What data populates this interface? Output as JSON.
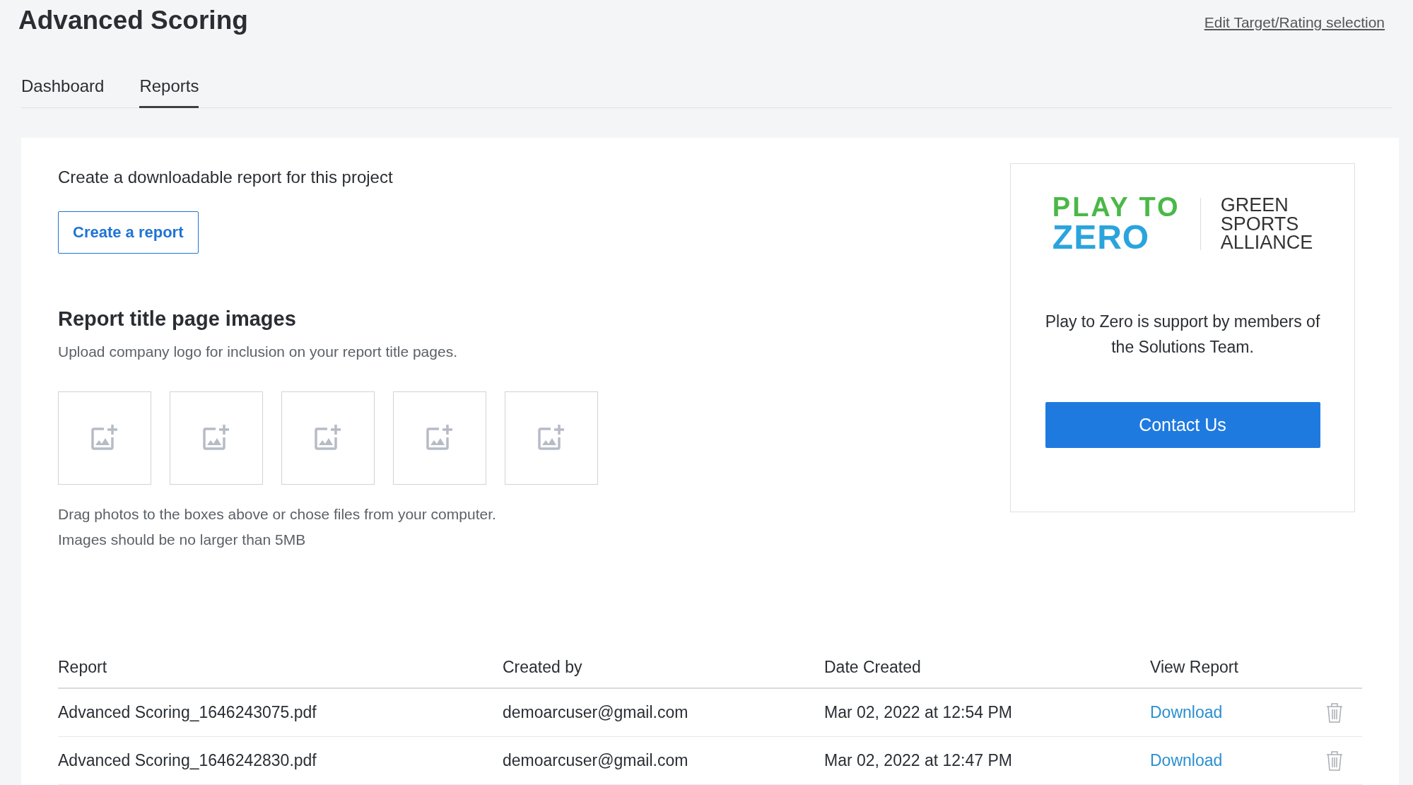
{
  "header": {
    "title": "Advanced Scoring",
    "edit_link": "Edit Target/Rating selection"
  },
  "tabs": [
    {
      "label": "Dashboard",
      "selected": false
    },
    {
      "label": "Reports",
      "selected": true
    }
  ],
  "create": {
    "text": "Create a downloadable report for this project",
    "button": "Create a report"
  },
  "images": {
    "heading": "Report title page images",
    "subtitle": "Upload company logo for inclusion on your report title pages.",
    "slots": [
      {
        "kind": "empty"
      },
      {
        "kind": "empty"
      },
      {
        "kind": "empty"
      },
      {
        "kind": "empty"
      },
      {
        "kind": "empty"
      }
    ],
    "hint_lines": [
      "Drag photos to the boxes above or chose files from your computer.",
      "Images should be no larger than 5MB"
    ]
  },
  "sponsor": {
    "logo_left": [
      "PLAY TO",
      "ZERO"
    ],
    "logo_right": [
      "GREEN",
      "SPORTS",
      "ALLIANCE"
    ],
    "text": "Play to Zero is support by members of the Solutions Team.",
    "button": "Contact Us"
  },
  "table": {
    "columns": [
      "Report",
      "Created by",
      "Date Created",
      "View Report"
    ],
    "rows": [
      {
        "report": "Advanced Scoring_1646243075.pdf",
        "created_by": "demoarcuser@gmail.com",
        "date": "Mar 02, 2022 at 12:54 PM",
        "link": "Download"
      },
      {
        "report": "Advanced Scoring_1646242830.pdf",
        "created_by": "demoarcuser@gmail.com",
        "date": "Mar 02, 2022 at 12:47 PM",
        "link": "Download"
      }
    ]
  }
}
